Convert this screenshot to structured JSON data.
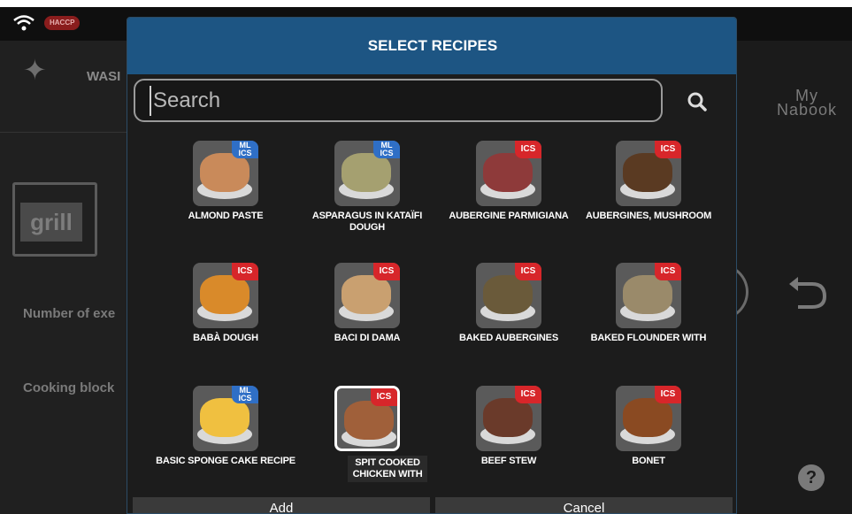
{
  "status": {
    "haccp": "HACCP"
  },
  "side_menu": {
    "wash_label": "WASI",
    "grill_label": "grill",
    "number_label": "Number of exe",
    "cooking_label": "Cooking block"
  },
  "right_panel": {
    "mynabook": "My\nNabook"
  },
  "modal": {
    "title": "SELECT RECIPES",
    "search_placeholder": "Search",
    "add_label": "Add",
    "cancel_label": "Cancel"
  },
  "recipes": [
    {
      "name": "ALMOND PASTE",
      "badge": "ML ICS",
      "color": "#c98a5a"
    },
    {
      "name": "ASPARAGUS IN KATAÏFI DOUGH",
      "badge": "ML ICS",
      "color": "#a5a070"
    },
    {
      "name": "AUBERGINE PARMIGIANA",
      "badge": "ICS",
      "color": "#8e3a3a"
    },
    {
      "name": "AUBERGINES, MUSHROOM",
      "badge": "ICS",
      "color": "#5a3a22"
    },
    {
      "name": "BABÀ DOUGH",
      "badge": "ICS",
      "color": "#d98a2a"
    },
    {
      "name": "BACI DI DAMA",
      "badge": "ICS",
      "color": "#c9a070"
    },
    {
      "name": "BAKED AUBERGINES",
      "badge": "ICS",
      "color": "#6a5a3a"
    },
    {
      "name": "BAKED FLOUNDER WITH",
      "badge": "ICS",
      "color": "#9a8a6a"
    },
    {
      "name": "BASIC SPONGE CAKE RECIPE",
      "badge": "ML ICS",
      "color": "#f0c040"
    },
    {
      "name": "SPIT COOKED CHICKEN WITH",
      "badge": "ICS",
      "color": "#a0603a"
    },
    {
      "name": "BEEF STEW",
      "badge": "ICS",
      "color": "#6a3a2a"
    },
    {
      "name": "BONET",
      "badge": "ICS",
      "color": "#8a4a22"
    }
  ]
}
